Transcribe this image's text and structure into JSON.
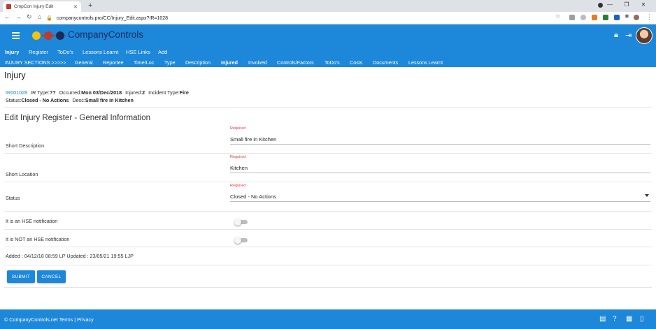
{
  "browser": {
    "tab_title": "CmpCon Injury Edit",
    "url": "companycontrols.pro/CC/Injury_Edit.aspx?IR=1028"
  },
  "app": {
    "brand": "CompanyControls",
    "colors": {
      "primary": "#1d87da",
      "brand_text": "#1a2b5a",
      "required": "#e53935",
      "logo_dots": [
        "#f1c40f",
        "#c0392b",
        "#1a2b5a"
      ]
    }
  },
  "menu": {
    "items": [
      "Injury",
      "Register",
      "ToDo's",
      "Lessons Learnt",
      "HSE Links",
      "Add"
    ]
  },
  "sections": {
    "prefix": "INJURY SECTIONS >>>>>",
    "items": [
      "General",
      "Reportee",
      "Time/Loc",
      "Type",
      "Description",
      "Injured",
      "Involved",
      "Controls/Factors",
      "ToDo's",
      "Costs",
      "Documents",
      "Lessons Learnt"
    ]
  },
  "page": {
    "heading": "Injury"
  },
  "summary": {
    "id_link": "IR001028",
    "ir_type_label": "IR Type:",
    "ir_type_value": "??",
    "occurred_label": "Occurred:",
    "occurred_value": "Mon 03/Dec/2018",
    "injured_label": "Injured:",
    "injured_value": "2",
    "incident_type_label": "Incident Type:",
    "incident_type_value": "Fire",
    "status_label": "Status:",
    "status_value": "Closed - No Actions",
    "desc_label": "Desc:",
    "desc_value": "Small fire in Kitchen"
  },
  "form": {
    "title": "Edit Injury Register - General Information",
    "required_text": "Required",
    "short_description": {
      "label": "Short Description",
      "value": "Small fire in Kitchen"
    },
    "short_location": {
      "label": "Short Location",
      "value": "Kitchen"
    },
    "status": {
      "label": "Status",
      "value": "Closed - No Actions"
    },
    "hse_notification": {
      "label": "It is an HSE notification",
      "on": false
    },
    "not_hse_notification": {
      "label": "It is NOT an HSE notification",
      "on": false
    },
    "audit": "Added : 04/12/18 08:59 LP Updated : 23/05/21 19:55 LJP",
    "submit_label": "SUBMIT",
    "cancel_label": "CANCEL"
  },
  "footer": {
    "copyright": "© CompanyControls.net",
    "terms": "Terms",
    "separator": "|",
    "privacy": "Privacy"
  }
}
